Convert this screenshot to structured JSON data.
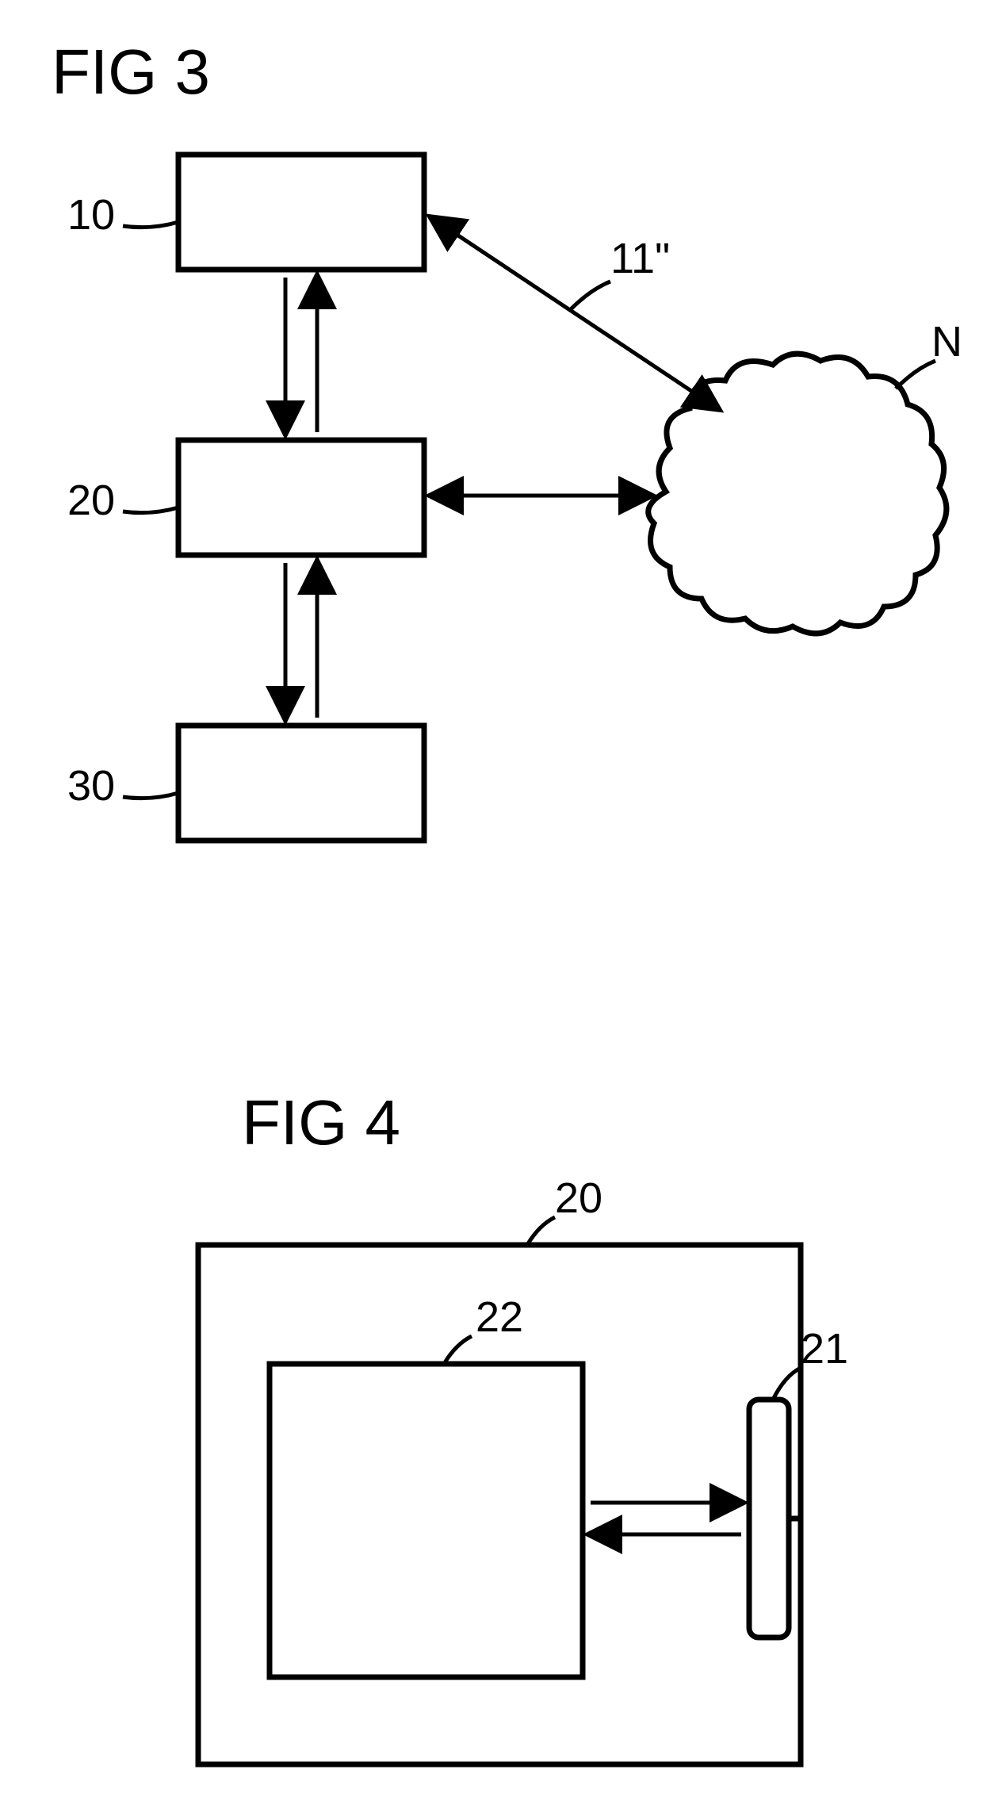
{
  "figures": {
    "fig3": {
      "title": "FIG 3",
      "labels": {
        "box10": "10",
        "box20": "20",
        "box30": "30",
        "arrow11": "11\"",
        "cloudN": "N"
      }
    },
    "fig4": {
      "title": "FIG 4",
      "labels": {
        "outer20": "20",
        "inner22": "22",
        "right21": "21"
      }
    }
  }
}
